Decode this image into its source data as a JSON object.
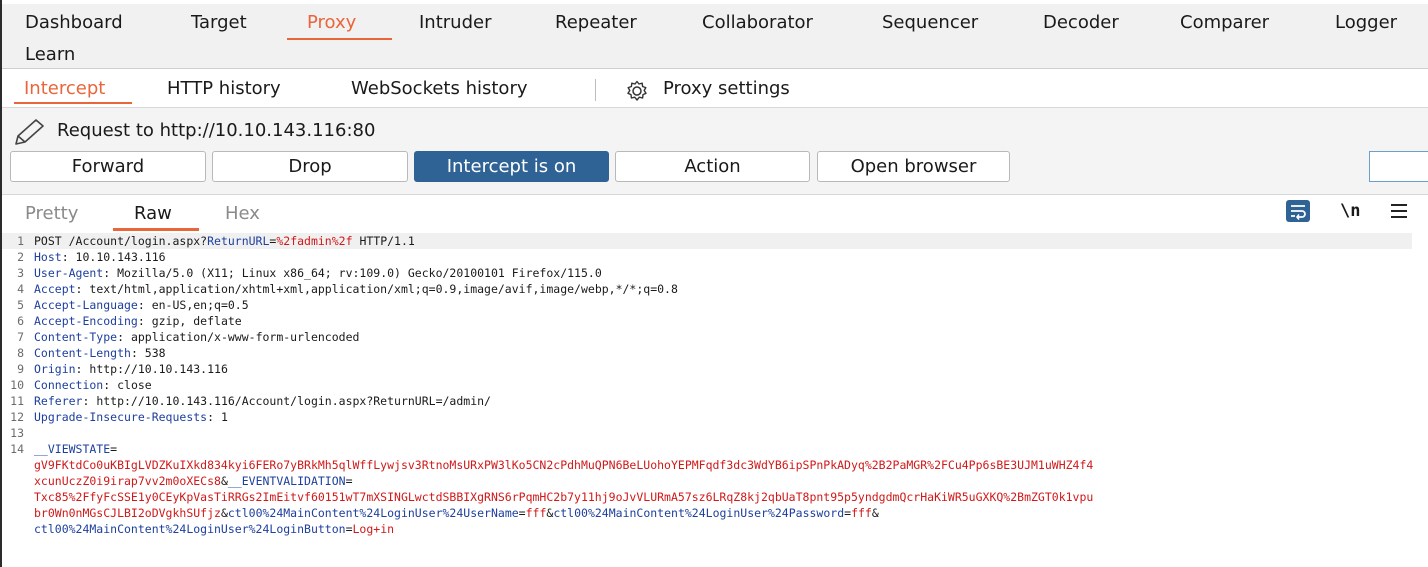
{
  "main_tabs": [
    "Dashboard",
    "Target",
    "Proxy",
    "Intruder",
    "Repeater",
    "Collaborator",
    "Sequencer",
    "Decoder",
    "Comparer",
    "Logger"
  ],
  "main_tab_learn": "Learn",
  "sub_tabs": [
    "Intercept",
    "HTTP history",
    "WebSockets history",
    "Proxy settings"
  ],
  "request_label": "Request to http://10.10.143.116:80",
  "buttons": {
    "forward": "Forward",
    "drop": "Drop",
    "intercept": "Intercept is on",
    "action": "Action",
    "open_browser": "Open browser"
  },
  "view_tabs": [
    "Pretty",
    "Raw",
    "Hex"
  ],
  "newline_toggle": "\\n",
  "lines": {
    "l1a": "POST /Account/login.aspx?",
    "l1b": "ReturnURL",
    "l1c": "=",
    "l1d": "%2fadmin%2f",
    "l1e": " HTTP/1.1",
    "l2a": "Host",
    "l2b": ": 10.10.143.116",
    "l3a": "User-Agent",
    "l3b": ": Mozilla/5.0 (X11; Linux x86_64; rv:109.0) Gecko/20100101 Firefox/115.0",
    "l4a": "Accept",
    "l4b": ": text/html,application/xhtml+xml,application/xml;q=0.9,image/avif,image/webp,*/*;q=0.8",
    "l5a": "Accept-Language",
    "l5b": ": en-US,en;q=0.5",
    "l6a": "Accept-Encoding",
    "l6b": ": gzip, deflate",
    "l7a": "Content-Type",
    "l7b": ": application/x-www-form-urlencoded",
    "l8a": "Content-Length",
    "l8b": ": 538",
    "l9a": "Origin",
    "l9b": ": http://10.10.143.116",
    "l10a": "Connection",
    "l10b": ": close",
    "l11a": "Referer",
    "l11b": ": http://10.10.143.116/Account/login.aspx?ReturnURL=/admin/",
    "l12a": "Upgrade-Insecure-Requests",
    "l12b": ": 1",
    "l14a": "__VIEWSTATE",
    "l14b": "=",
    "b1": "gV9FKtdCo0uKBIgLVDZKuIXkd834kyi6FERo7yBRkMh5qlWffLywjsv3RtnoMsURxPW3lKo5CN2cPdhMuQPN6BeLUohoYEPMFqdf3dc3WdYB6ipSPnPkADyq%2B2PaMGR%2FCu4Pp6sBE3UJM1uWHZ4f4",
    "b2a": "xcunUczZ0i9irap7vv2m0oXECs8",
    "b2b": "&",
    "b2c": "__EVENTVALIDATION",
    "b2d": "=",
    "b3": "Txc85%2FfyFcSSE1y0CEyKpVasTiRRGs2ImEitvf60151wT7mXSINGLwctdSBBIXgRNS6rPqmHC2b7y11hj9oJvVLURmA57sz6LRqZ8kj2qbUaT8pnt95p5yndgdmQcrHaKiWR5uGXKQ%2BmZGT0k1vpu",
    "b4a": "br0Wn0nMGsCJLBI2oDVgkhSUfjz",
    "b4b": "&",
    "b4c": "ctl00%24MainContent%24LoginUser%24UserName",
    "b4d": "=",
    "b4e": "fff",
    "b4f": "&",
    "b4g": "ctl00%24MainContent%24LoginUser%24Password",
    "b4h": "=",
    "b4i": "fff",
    "b4j": "&",
    "b5a": "ctl00%24MainContent%24LoginUser%24LoginButton",
    "b5b": "=",
    "b5c": "Log+in"
  }
}
